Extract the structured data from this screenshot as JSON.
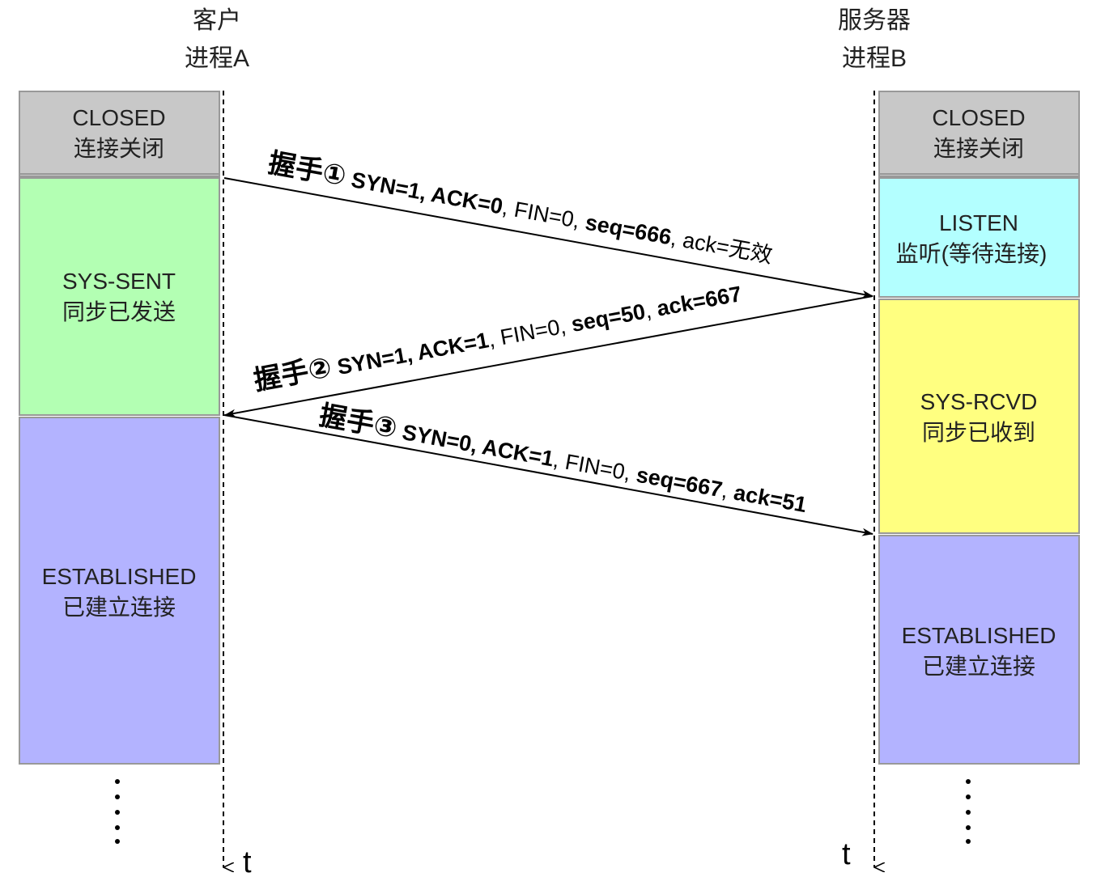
{
  "client": {
    "title_line1": "客户",
    "title_line2": "进程A",
    "time_label": "t"
  },
  "server": {
    "title_line1": "服务器",
    "title_line2": "进程B",
    "time_label": "t"
  },
  "colors": {
    "closed": "#c8c8c8",
    "syn_sent": "#b3ffb3",
    "listen": "#b3ffff",
    "syn_rcvd": "#ffff80",
    "established": "#b3b3ff",
    "box_border": "#999999",
    "line": "#000000"
  },
  "client_states": [
    {
      "name": "closed-state",
      "line1": "CLOSED",
      "line2": "连接关闭",
      "color_key": "closed"
    },
    {
      "name": "sys-sent-state",
      "line1": "SYS-SENT",
      "line2": "同步已发送",
      "color_key": "syn_sent"
    },
    {
      "name": "established-state",
      "line1": "ESTABLISHED",
      "line2": "已建立连接",
      "color_key": "established"
    }
  ],
  "server_states": [
    {
      "name": "closed-state",
      "line1": "CLOSED",
      "line2": "连接关闭",
      "color_key": "closed"
    },
    {
      "name": "listen-state",
      "line1": "LISTEN",
      "line2": "监听(等待连接)",
      "color_key": "listen"
    },
    {
      "name": "sys-rcvd-state",
      "line1": "SYS-RCVD",
      "line2": "同步已收到",
      "color_key": "syn_rcvd"
    },
    {
      "name": "established-state",
      "line1": "ESTABLISHED",
      "line2": "已建立连接",
      "color_key": "established"
    }
  ],
  "handshakes": [
    {
      "title": "握手①",
      "parts": [
        {
          "text": " SYN=1, ",
          "bold": true
        },
        {
          "text": "ACK=0",
          "bold": true
        },
        {
          "text": ", FIN=0, ",
          "bold": false
        },
        {
          "text": "seq=666",
          "bold": true
        },
        {
          "text": ", ack=无效",
          "bold": false
        }
      ]
    },
    {
      "title": "握手②",
      "parts": [
        {
          "text": " SYN=1, ",
          "bold": true
        },
        {
          "text": "ACK=1",
          "bold": true
        },
        {
          "text": ", FIN=0, ",
          "bold": false
        },
        {
          "text": "seq=50",
          "bold": true
        },
        {
          "text": ", ",
          "bold": false
        },
        {
          "text": "ack=667",
          "bold": true
        }
      ]
    },
    {
      "title": "握手③",
      "parts": [
        {
          "text": " SYN=0, ",
          "bold": true
        },
        {
          "text": "ACK=1",
          "bold": true
        },
        {
          "text": ", FIN=0, ",
          "bold": false
        },
        {
          "text": "seq=667",
          "bold": true
        },
        {
          "text": ", ",
          "bold": false
        },
        {
          "text": "ack=51",
          "bold": true
        }
      ]
    }
  ]
}
